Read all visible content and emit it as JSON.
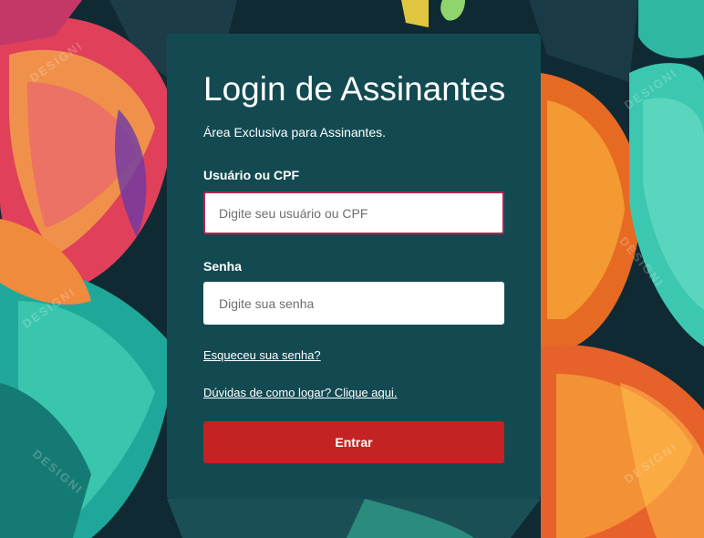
{
  "login": {
    "title": "Login de Assinantes",
    "subtitle": "Área Exclusiva para Assinantes.",
    "username_label": "Usuário ou CPF",
    "username_placeholder": "Digite seu usuário ou CPF",
    "password_label": "Senha",
    "password_placeholder": "Digite sua senha",
    "forgot_password": "Esqueceu sua senha?",
    "help_link": "Dúvidas de como logar? Clique aqui.",
    "submit": "Entrar"
  },
  "colors": {
    "card_bg": "#134a52",
    "button_bg": "#c42323",
    "focus_border": "#b8234d"
  }
}
